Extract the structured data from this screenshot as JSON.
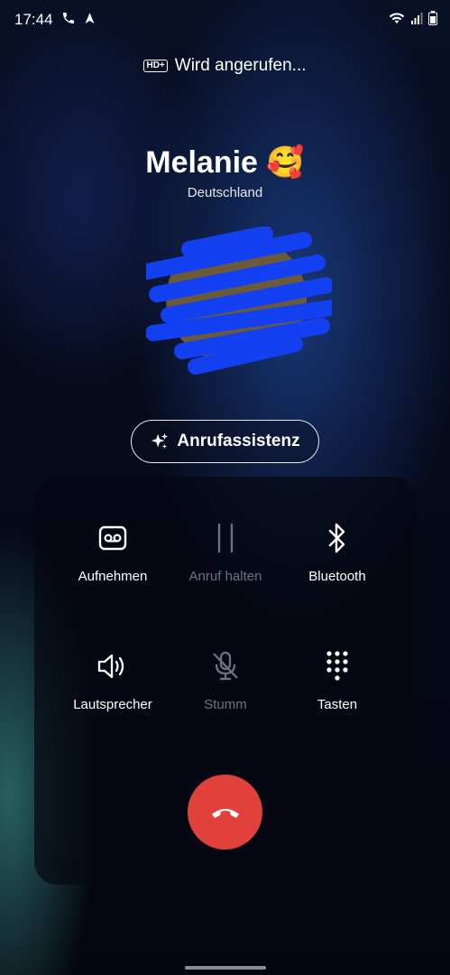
{
  "status_bar": {
    "time": "17:44",
    "left_icons": [
      "phone-icon",
      "navigation-icon"
    ],
    "right_icons": [
      "wifi-icon",
      "signal-icon",
      "battery-icon"
    ]
  },
  "call": {
    "hd_badge": "HD+",
    "status_text": "Wird angerufen..."
  },
  "contact": {
    "name": "Melanie 🥰",
    "country": "Deutschland"
  },
  "assist_button": {
    "icon": "sparkles-icon",
    "label": "Anrufassistenz"
  },
  "controls": [
    {
      "id": "record",
      "icon": "voicemail-icon",
      "label": "Aufnehmen",
      "enabled": true
    },
    {
      "id": "hold",
      "icon": "pause-icon",
      "label": "Anruf halten",
      "enabled": false
    },
    {
      "id": "bluetooth",
      "icon": "bluetooth-icon",
      "label": "Bluetooth",
      "enabled": true
    },
    {
      "id": "speaker",
      "icon": "speaker-icon",
      "label": "Lautsprecher",
      "enabled": true
    },
    {
      "id": "mute",
      "icon": "mic-off-icon",
      "label": "Stumm",
      "enabled": false
    },
    {
      "id": "keypad",
      "icon": "keypad-icon",
      "label": "Tasten",
      "enabled": true
    }
  ],
  "end_call": {
    "icon": "end-call-icon",
    "color": "#E0413B"
  }
}
